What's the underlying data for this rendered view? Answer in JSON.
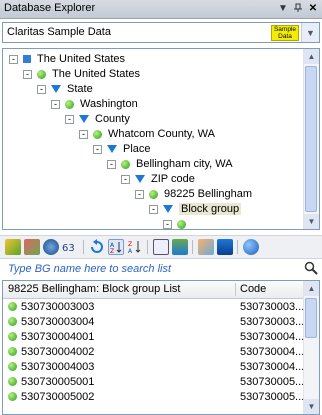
{
  "panel": {
    "title": "Database Explorer"
  },
  "titlebar": {
    "pin_icon": "pin-icon",
    "menu_icon": "dropdown-arrow-icon",
    "close_icon": "close-icon"
  },
  "dataset": {
    "selected": "Claritas Sample Data",
    "badge_line1": "Sample",
    "badge_line2": "Data"
  },
  "tree": [
    {
      "level": 0,
      "icon": "square",
      "label": "The United States",
      "expander": "-"
    },
    {
      "level": 1,
      "icon": "dot",
      "label": "The United States",
      "expander": "-"
    },
    {
      "level": 2,
      "icon": "triangle",
      "label": "State",
      "expander": "-"
    },
    {
      "level": 3,
      "icon": "dot",
      "label": "Washington",
      "expander": "-"
    },
    {
      "level": 4,
      "icon": "triangle",
      "label": "County",
      "expander": "-"
    },
    {
      "level": 5,
      "icon": "dot",
      "label": "Whatcom County, WA",
      "expander": "-"
    },
    {
      "level": 6,
      "icon": "triangle",
      "label": "Place",
      "expander": "-"
    },
    {
      "level": 7,
      "icon": "dot",
      "label": "Bellingham city, WA",
      "expander": "-"
    },
    {
      "level": 8,
      "icon": "triangle",
      "label": "ZIP code",
      "expander": "-"
    },
    {
      "level": 9,
      "icon": "dot",
      "label": "98225  Bellingham",
      "expander": "-"
    },
    {
      "level": 10,
      "icon": "triangle",
      "label": "Block group",
      "expander": "-",
      "selected": true
    },
    {
      "level": 11,
      "icon": "dot",
      "label": "",
      "expander": "-"
    }
  ],
  "search": {
    "placeholder": "Type BG name here to search list"
  },
  "list": {
    "col_name": "98225  Bellingham: Block group List",
    "col_code": "Code",
    "rows": [
      {
        "name": "530730003003",
        "code": "530730003..."
      },
      {
        "name": "530730003004",
        "code": "530730003..."
      },
      {
        "name": "530730004001",
        "code": "530730004..."
      },
      {
        "name": "530730004002",
        "code": "530730004..."
      },
      {
        "name": "530730004003",
        "code": "530730004..."
      },
      {
        "name": "530730005001",
        "code": "530730005..."
      },
      {
        "name": "530730005002",
        "code": "530730005..."
      }
    ]
  }
}
